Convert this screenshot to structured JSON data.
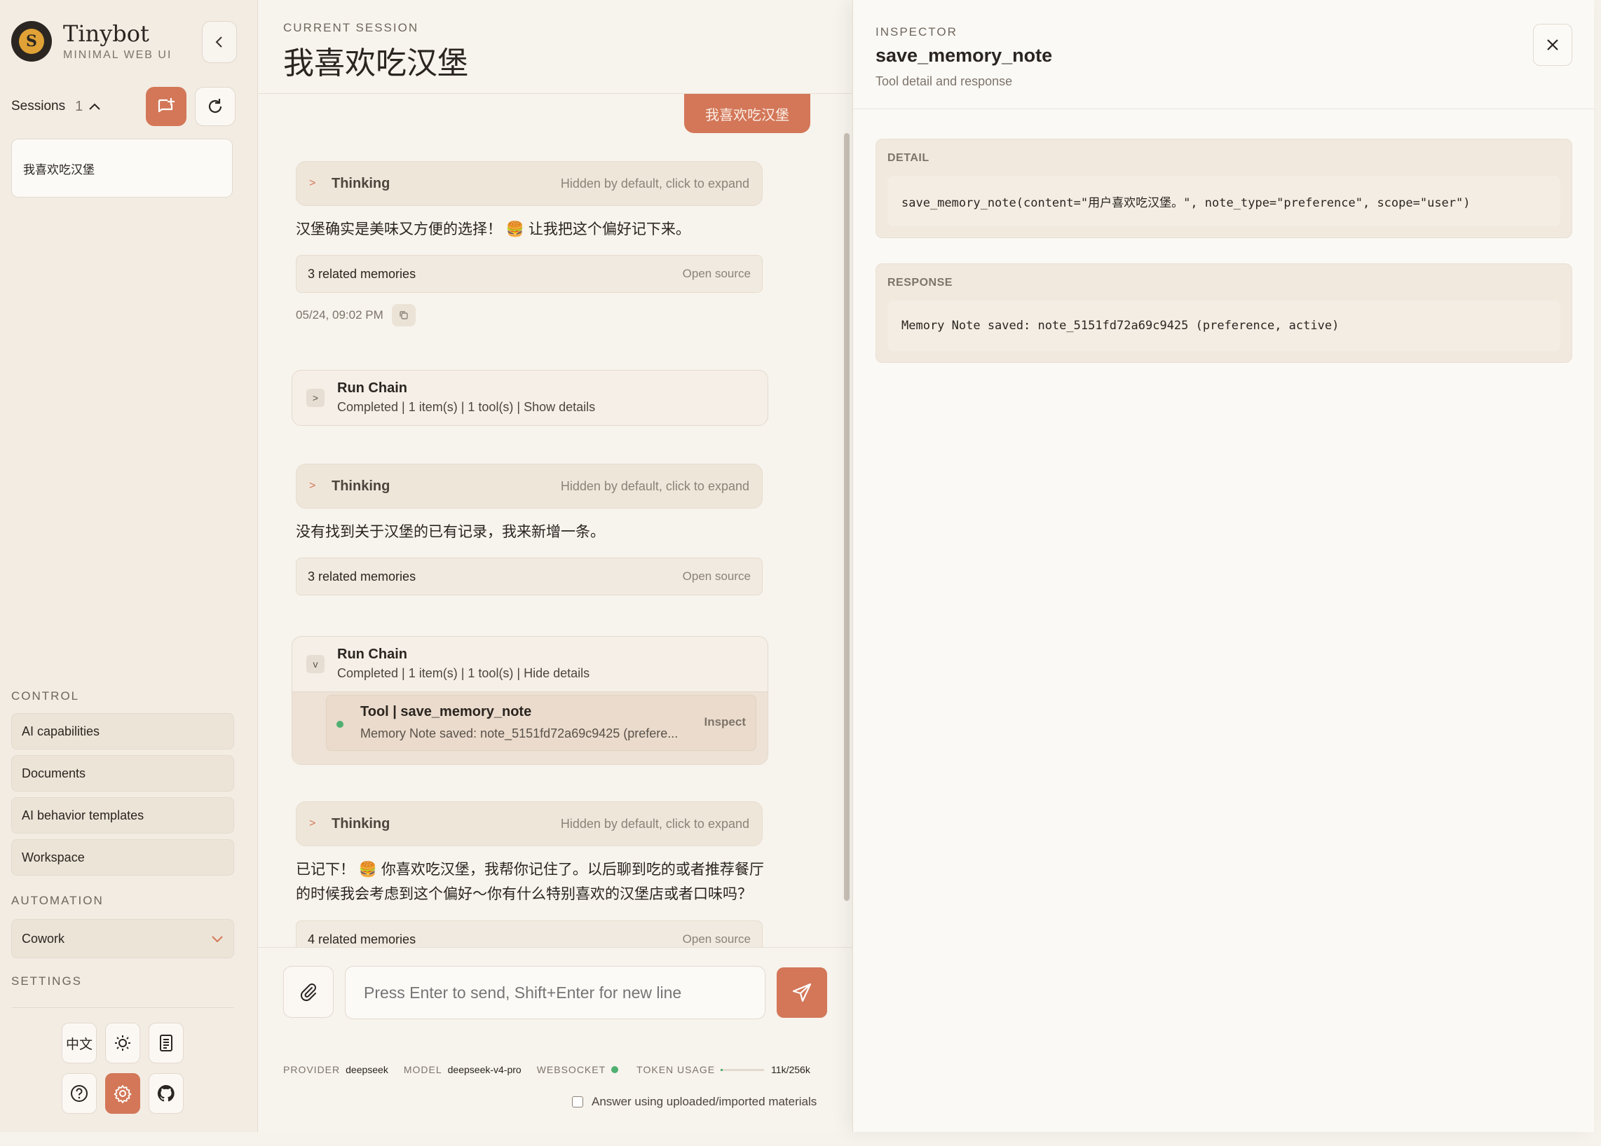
{
  "sidebar": {
    "brand_name": "Tinybot",
    "brand_sub": "MINIMAL WEB UI",
    "sessions_label": "Sessions",
    "sessions_count": "1",
    "sessions": [
      {
        "title": "我喜欢吃汉堡"
      }
    ],
    "control_title": "CONTROL",
    "control_items": [
      {
        "label": "AI capabilities"
      },
      {
        "label": "Documents"
      },
      {
        "label": "AI behavior templates"
      },
      {
        "label": "Workspace"
      }
    ],
    "automation_title": "AUTOMATION",
    "automation_select": "Cowork",
    "settings_title": "SETTINGS",
    "language_label": "中文"
  },
  "chat": {
    "session_label": "CURRENT SESSION",
    "session_title": "我喜欢吃汉堡",
    "user_message": "我喜欢吃汉堡",
    "thinking_label": "Thinking",
    "thinking_hint": "Hidden by default, click to expand",
    "assistant_1": "汉堡确实是美味又方便的选择！ 🍔 让我把这个偏好记下来。",
    "memories_1": "3 related memories",
    "open_source": "Open source",
    "timestamp": "05/24, 09:02 PM",
    "runchain_title": "Run Chain",
    "runchain_1_sub": "Completed | 1 item(s) | 1 tool(s) | Show details",
    "assistant_2": "没有找到关于汉堡的已有记录，我来新增一条。",
    "memories_2": "3 related memories",
    "runchain_2_sub": "Completed | 1 item(s) | 1 tool(s) | Hide details",
    "tool_title": "Tool | save_memory_note",
    "tool_desc": "Memory Note saved: note_5151fd72a69c9425 (prefere...",
    "tool_inspect": "Inspect",
    "assistant_3": "已记下！ 🍔 你喜欢吃汉堡，我帮你记住了。以后聊到吃的或者推荐餐厅的时候我会考虑到这个偏好～你有什么特别喜欢的汉堡店或者口味吗？",
    "memories_3": "4 related memories"
  },
  "composer": {
    "placeholder": "Press Enter to send, Shift+Enter for new line",
    "provider_label": "PROVIDER",
    "provider_value": "deepseek",
    "model_label": "MODEL",
    "model_value": "deepseek-v4-pro",
    "websocket_label": "WEBSOCKET",
    "token_label": "TOKEN USAGE",
    "token_value": "11k/256k",
    "token_fraction": 0.043,
    "checkbox_label": "Answer using uploaded/imported materials"
  },
  "inspector": {
    "label": "INSPECTOR",
    "title": "save_memory_note",
    "subtitle": "Tool detail and response",
    "detail_label": "DETAIL",
    "detail_code": "save_memory_note(content=\"用户喜欢吃汉堡。\", note_type=\"preference\", scope=\"user\")",
    "response_label": "RESPONSE",
    "response_code": "Memory Note saved: note_5151fd72a69c9425 (preference, active)"
  },
  "colors": {
    "accent": "#d37758",
    "status_ok": "#4fb071"
  }
}
